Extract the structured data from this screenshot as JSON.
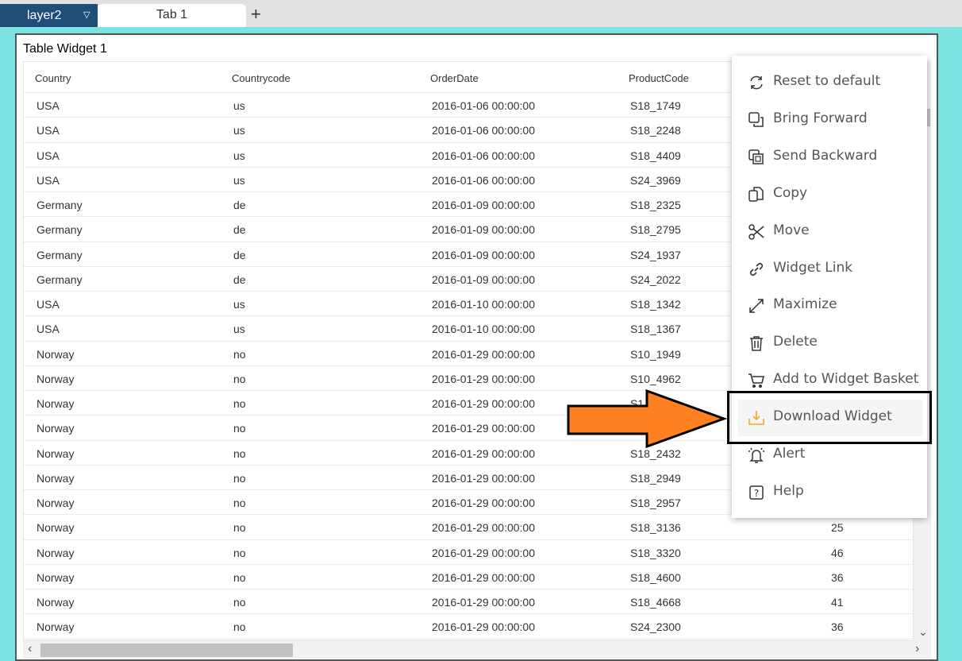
{
  "tabs": {
    "layer": "layer2",
    "tab": "Tab 1",
    "add": "+"
  },
  "widget": {
    "title": "Table Widget 1"
  },
  "table": {
    "columns": [
      "Country",
      "Countrycode",
      "OrderDate",
      "ProductCode",
      ""
    ],
    "rows": [
      [
        "USA",
        "us",
        "2016-01-06 00:00:00",
        "S18_1749",
        ""
      ],
      [
        "USA",
        "us",
        "2016-01-06 00:00:00",
        "S18_2248",
        ""
      ],
      [
        "USA",
        "us",
        "2016-01-06 00:00:00",
        "S18_4409",
        ""
      ],
      [
        "USA",
        "us",
        "2016-01-06 00:00:00",
        "S24_3969",
        ""
      ],
      [
        "Germany",
        "de",
        "2016-01-09 00:00:00",
        "S18_2325",
        ""
      ],
      [
        "Germany",
        "de",
        "2016-01-09 00:00:00",
        "S18_2795",
        ""
      ],
      [
        "Germany",
        "de",
        "2016-01-09 00:00:00",
        "S24_1937",
        ""
      ],
      [
        "Germany",
        "de",
        "2016-01-09 00:00:00",
        "S24_2022",
        ""
      ],
      [
        "USA",
        "us",
        "2016-01-10 00:00:00",
        "S18_1342",
        ""
      ],
      [
        "USA",
        "us",
        "2016-01-10 00:00:00",
        "S18_1367",
        ""
      ],
      [
        "Norway",
        "no",
        "2016-01-29 00:00:00",
        "S10_1949",
        ""
      ],
      [
        "Norway",
        "no",
        "2016-01-29 00:00:00",
        "S10_4962",
        ""
      ],
      [
        "Norway",
        "no",
        "2016-01-29 00:00:00",
        "S1",
        ""
      ],
      [
        "Norway",
        "no",
        "2016-01-29 00:00:00",
        "",
        ""
      ],
      [
        "Norway",
        "no",
        "2016-01-29 00:00:00",
        "S18_2432",
        ""
      ],
      [
        "Norway",
        "no",
        "2016-01-29 00:00:00",
        "S18_2949",
        ""
      ],
      [
        "Norway",
        "no",
        "2016-01-29 00:00:00",
        "S18_2957",
        ""
      ],
      [
        "Norway",
        "no",
        "2016-01-29 00:00:00",
        "S18_3136",
        "25"
      ],
      [
        "Norway",
        "no",
        "2016-01-29 00:00:00",
        "S18_3320",
        "46"
      ],
      [
        "Norway",
        "no",
        "2016-01-29 00:00:00",
        "S18_4600",
        "36"
      ],
      [
        "Norway",
        "no",
        "2016-01-29 00:00:00",
        "S18_4668",
        "41"
      ],
      [
        "Norway",
        "no",
        "2016-01-29 00:00:00",
        "S24_2300",
        "36"
      ]
    ]
  },
  "menu": {
    "items": [
      {
        "label": "Reset to default",
        "icon": "refresh-icon"
      },
      {
        "label": "Bring Forward",
        "icon": "bring-forward-icon"
      },
      {
        "label": "Send Backward",
        "icon": "send-backward-icon"
      },
      {
        "label": "Copy",
        "icon": "copy-icon"
      },
      {
        "label": "Move",
        "icon": "scissors-icon"
      },
      {
        "label": "Widget Link",
        "icon": "link-icon"
      },
      {
        "label": "Maximize",
        "icon": "maximize-icon"
      },
      {
        "label": "Delete",
        "icon": "trash-icon"
      },
      {
        "label": "Add to Widget Basket",
        "icon": "cart-icon"
      },
      {
        "label": "Download Widget",
        "icon": "download-icon",
        "highlighted": true
      },
      {
        "label": "Alert",
        "icon": "bell-icon"
      },
      {
        "label": "Help",
        "icon": "help-icon"
      }
    ]
  },
  "colors": {
    "layer_tab": "#1f4e79",
    "background": "#7de3e1",
    "arrow": "#ff8122",
    "download_icon": "#f5a623"
  }
}
